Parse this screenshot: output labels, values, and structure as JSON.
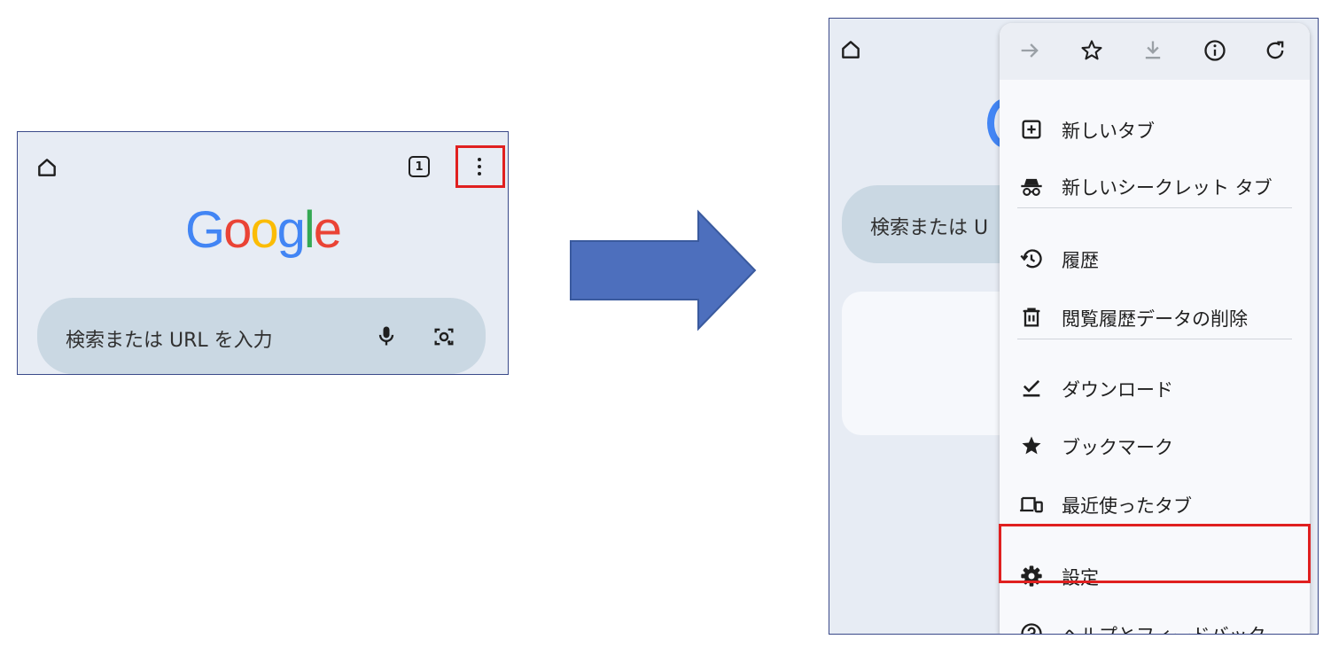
{
  "left": {
    "tab_count": "1",
    "logo": [
      "G",
      "o",
      "o",
      "g",
      "l",
      "e"
    ],
    "search_placeholder": "検索または URL を入力"
  },
  "right": {
    "search_placeholder_partial": "検索または U",
    "menu": {
      "items": [
        {
          "label": "新しいタブ",
          "icon": "plus-box-icon"
        },
        {
          "label": "新しいシークレット タブ",
          "icon": "incognito-icon"
        },
        {
          "label": "履歴",
          "icon": "history-icon"
        },
        {
          "label": "閲覧履歴データの削除",
          "icon": "trash-icon"
        },
        {
          "label": "ダウンロード",
          "icon": "download-check-icon"
        },
        {
          "label": "ブックマーク",
          "icon": "star-filled-icon"
        },
        {
          "label": "最近使ったタブ",
          "icon": "devices-icon"
        },
        {
          "label": "設定",
          "icon": "gear-icon"
        },
        {
          "label": "ヘルプとフィードバック",
          "icon": "help-circle-icon"
        }
      ]
    }
  },
  "colors": {
    "highlight": "#e02020",
    "arrow": "#4d6fbd",
    "google_blue": "#4285f4",
    "google_red": "#ea4335",
    "google_yellow": "#fbbc05",
    "google_green": "#34a853"
  }
}
